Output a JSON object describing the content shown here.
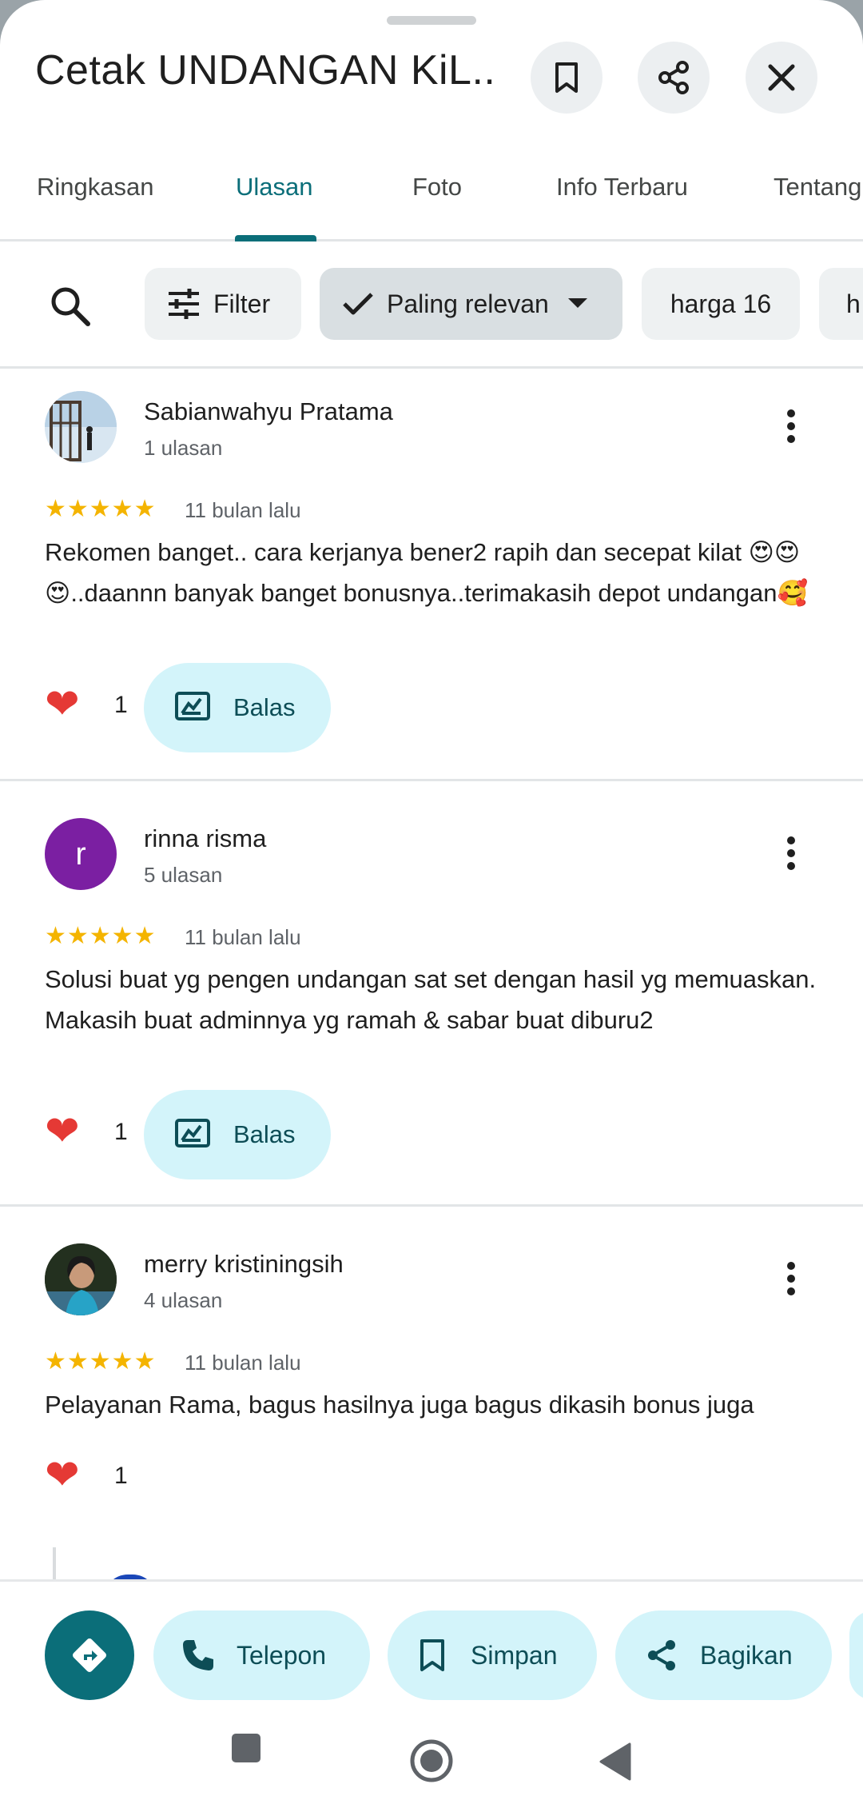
{
  "header": {
    "title": "Cetak UNDANGAN KiL..."
  },
  "tabs": [
    "Ringkasan",
    "Ulasan",
    "Foto",
    "Info Terbaru",
    "Tentang"
  ],
  "chips": {
    "filter": "Filter",
    "sort": "Paling relevan",
    "topic1": "harga 16",
    "topic2": "h"
  },
  "reviews": [
    {
      "name": "Sabianwahyu Pratama",
      "count": "1 ulasan",
      "stars": "★★★★★",
      "rating": 5,
      "time": "11 bulan lalu",
      "text": "Rekomen banget.. cara kerjanya bener2 rapih dan secepat kilat 😍😍😍..daannn banyak banget bonusnya..terimakasih depot undangan🥰",
      "likes": "1",
      "reply": "Balas"
    },
    {
      "name": "rinna risma",
      "initial": "r",
      "count": "5 ulasan",
      "stars": "★★★★★",
      "rating": 5,
      "time": "11 bulan lalu",
      "text": "Solusi buat yg pengen undangan sat set dengan hasil yg memuaskan. Makasih buat adminnya yg ramah & sabar buat diburu2",
      "likes": "1",
      "reply": "Balas"
    },
    {
      "name": "merry kristiningsih",
      "count": "4 ulasan",
      "stars": "★★★★★",
      "rating": 5,
      "time": "11 bulan lalu",
      "text": "Pelayanan Rama, bagus hasilnya juga bagus dikasih bonus juga",
      "likes": "1"
    }
  ],
  "actions": {
    "phone": "Telepon",
    "save": "Simpan",
    "share": "Bagikan"
  },
  "colors": {
    "accent": "#0b6e79",
    "chip_tonal": "#d3f4fa",
    "star": "#f4b400",
    "heart": "#e53935",
    "avatar_purple": "#7b1fa2"
  }
}
